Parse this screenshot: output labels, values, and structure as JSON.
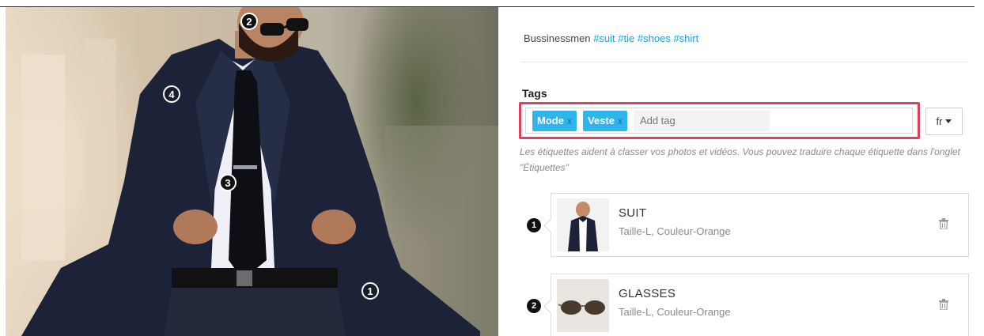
{
  "photo": {
    "pins": [
      {
        "label": "2",
        "style": "dark"
      },
      {
        "label": "4",
        "style": "light"
      },
      {
        "label": "3",
        "style": "dark"
      },
      {
        "label": "1",
        "style": "light"
      }
    ]
  },
  "caption": {
    "text": "Bussinessmen",
    "hashtags": [
      "#suit",
      "#tie",
      "#shoes",
      "#shirt"
    ]
  },
  "tags": {
    "label": "Tags",
    "chips": [
      {
        "label": "Mode",
        "remove": "x"
      },
      {
        "label": "Veste",
        "remove": "x"
      }
    ],
    "input_placeholder": "Add tag",
    "language": "fr",
    "help_text": "Les étiquettes aident à classer vos photos et vidéos. Vous pouvez traduire chaque étiquette dans l'onglet \"Étiquettes\""
  },
  "items": [
    {
      "number": "1",
      "name": "SUIT",
      "detail": "Taille-L, Couleur-Orange",
      "icon": "trash-icon"
    },
    {
      "number": "2",
      "name": "GLASSES",
      "detail": "Taille-L, Couleur-Orange",
      "icon": "trash-icon"
    }
  ],
  "colors": {
    "accent": "#2fb5ee",
    "highlight_border": "#e0405f",
    "hashtag": "#1e9fd8"
  }
}
